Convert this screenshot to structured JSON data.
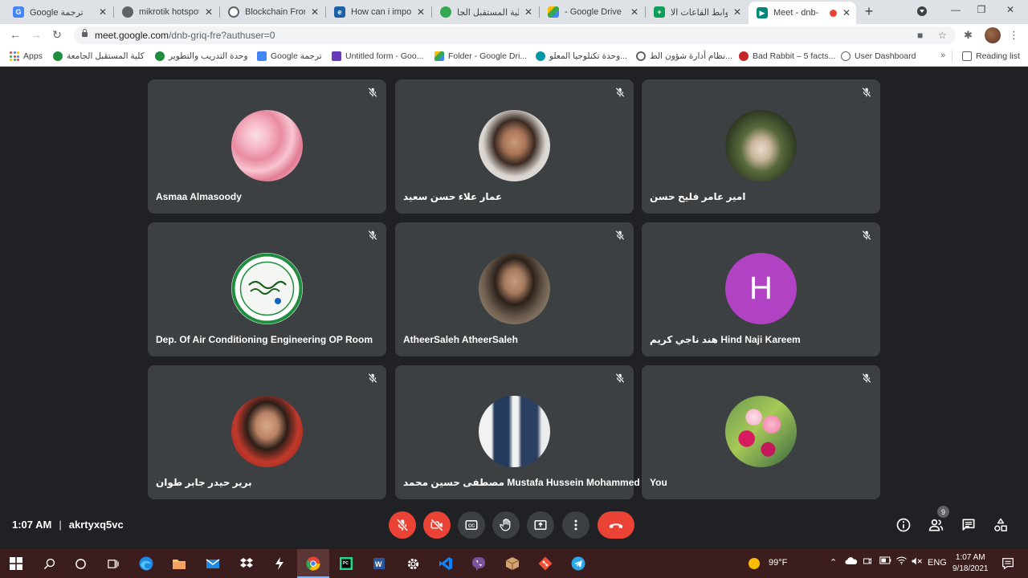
{
  "browser": {
    "tabs": [
      {
        "title": "Google ترجمة",
        "icon": "google-translate-icon",
        "color": "#4285f4"
      },
      {
        "title": "mikrotik hotspot",
        "icon": "mikrotik-icon",
        "color": "#5f6368"
      },
      {
        "title": "Blockchain Fronte",
        "icon": "globe-icon",
        "color": "#5f6368"
      },
      {
        "title": "How can i import",
        "icon": "edureka-icon",
        "color": "#1f5fa8"
      },
      {
        "title": "كلية المستقبل الجا",
        "icon": "college-icon",
        "color": "#34a853"
      },
      {
        "title": "- Google Drive",
        "icon": "google-drive-icon",
        "color": "#fbbc04"
      },
      {
        "title": "روابط القاعات الا",
        "icon": "google-sheets-icon",
        "color": "#0f9d58"
      },
      {
        "title": "Meet - dnb-",
        "icon": "google-meet-icon",
        "color": "#00897b",
        "active": true
      }
    ],
    "url_host": "meet.google.com",
    "url_path": "/dnb-griq-fre?authuser=0",
    "bookmarks": [
      {
        "label": "Apps",
        "icon": "apps-icon"
      },
      {
        "label": "كلية المستقبل الجامعة",
        "icon": "college-icon"
      },
      {
        "label": "وحدة التدريب والتطوير",
        "icon": "college-icon"
      },
      {
        "label": "Google ترجمة",
        "icon": "google-translate-icon"
      },
      {
        "label": "Untitled form - Goo...",
        "icon": "google-forms-icon"
      },
      {
        "label": "Folder - Google Dri...",
        "icon": "google-drive-icon"
      },
      {
        "label": "وحدة تكنلوجيا المعلو...",
        "icon": "site-icon"
      },
      {
        "label": "نظام أدارة شؤون الط...",
        "icon": "globe-icon"
      },
      {
        "label": "Bad Rabbit – 5 facts...",
        "icon": "kaspersky-icon"
      },
      {
        "label": "User Dashboard",
        "icon": "dashboard-icon"
      }
    ],
    "more_bookmarks": "»",
    "reading_list": "Reading list"
  },
  "meet": {
    "participants": [
      {
        "name": "Asmaa Almasoody",
        "avatar": "roses-photo"
      },
      {
        "name": "عمار علاء حسن سعيد",
        "avatar": "man-beard-photo"
      },
      {
        "name": "امير عامر فليح حسن",
        "avatar": "man-sitting-photo"
      },
      {
        "name": "Dep. Of Air Conditioning Engineering OP Room",
        "avatar": "university-logo"
      },
      {
        "name": "AtheerSaleh AtheerSaleh",
        "avatar": "man-portrait-photo"
      },
      {
        "name": "هند ناجي كريم Hind Naji Kareem",
        "avatar": "initial",
        "initial": "H",
        "color": "#b042c3"
      },
      {
        "name": "برير حيدر جابر طوان",
        "avatar": "man-selfie-photo"
      },
      {
        "name": "مصطفى حسين محمد Mustafa Hussein Mohammed",
        "avatar": "two-men-photo"
      },
      {
        "name": "You",
        "avatar": "flowers-photo"
      }
    ],
    "time": "1:07 AM",
    "separator": "|",
    "meeting_code": "akrtyxq5vc",
    "participant_count": "9"
  },
  "taskbar": {
    "weather": "99°F",
    "language": "ENG",
    "clock_time": "1:07 AM",
    "clock_date": "9/18/2021"
  },
  "colors": {
    "meet_bg": "#202124",
    "tile_bg": "#3c4043",
    "danger": "#ea4335",
    "taskbar": "#3b1d1d"
  }
}
